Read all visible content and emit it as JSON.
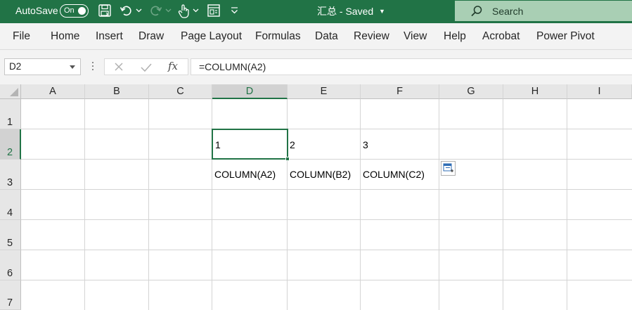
{
  "titlebar": {
    "autosave_label": "AutoSave",
    "autosave_state": "On",
    "document_title": "汇总",
    "document_status": "- Saved",
    "search_placeholder": "Search",
    "icons": [
      "save-icon",
      "undo-icon",
      "redo-icon",
      "touch-mode-icon",
      "form-icon",
      "customize-toolbar-icon"
    ]
  },
  "menu": {
    "items": [
      "File",
      "Home",
      "Insert",
      "Draw",
      "Page Layout",
      "Formulas",
      "Data",
      "Review",
      "View",
      "Help",
      "Acrobat",
      "Power Pivot"
    ]
  },
  "formula_bar": {
    "name_box": "D2",
    "fx": "fx",
    "formula": "=COLUMN(A2)"
  },
  "grid": {
    "columns": [
      "A",
      "B",
      "C",
      "D",
      "E",
      "F",
      "G",
      "H",
      "I"
    ],
    "rows": [
      "1",
      "2",
      "3",
      "4",
      "5",
      "6",
      "7"
    ],
    "selected_column": "D",
    "selected_row": "2",
    "cells": {
      "D2": "1",
      "E2": "2",
      "F2": "3",
      "D3": "COLUMN(A2)",
      "E3": "COLUMN(B2)",
      "F3": "COLUMN(C2)"
    }
  },
  "colors": {
    "accent": "#217346",
    "search_bg": "#a9cfb4",
    "ribbon_bg": "#f3f3f3",
    "header_bg": "#e6e6e6"
  }
}
